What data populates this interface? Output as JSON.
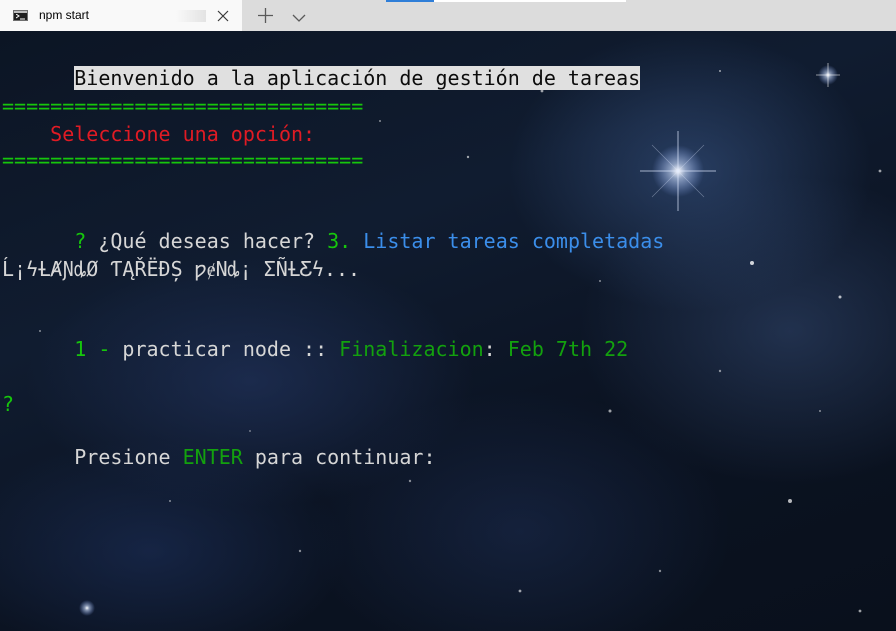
{
  "tab": {
    "title": "npm start",
    "icon": "terminal-icon",
    "close_icon": "close-icon",
    "new_tab_icon": "plus-icon",
    "dropdown_icon": "chevron-down-icon"
  },
  "terminal": {
    "welcome": "Bienvenido a la aplicación de gestión de tareas",
    "separator": "==============================",
    "menu_title": "    Seleccione una opción:",
    "prompt_mark": "?",
    "question": " ¿Qué deseas hacer? ",
    "answer_number": "3.",
    "answer_text": " Listar tareas completadas",
    "spinner": "Ĺ¡ϟȽȺƝȡØ ƬĄŘËĐȘ ƿɇNȡ¡ ƩÑȽƸϟ...",
    "task_index": "1 - ",
    "task_name": "practicar node",
    "task_sep": " :: ",
    "task_label": "Finalizacion",
    "task_colon": ": ",
    "task_date": "Feb 7th 22",
    "continue_mark": "?",
    "continue_prefix": "Presione ",
    "continue_key": "ENTER",
    "continue_suffix": " para continuar:"
  },
  "colors": {
    "tabbar_bg": "#dcdcdc",
    "tab_bg": "#f9f9f9",
    "accent": "#2f7ed8",
    "green": "#16c60c",
    "dark_green": "#13a10e",
    "red": "#e01b24",
    "blue": "#3b8eea",
    "text": "#cccccc"
  }
}
